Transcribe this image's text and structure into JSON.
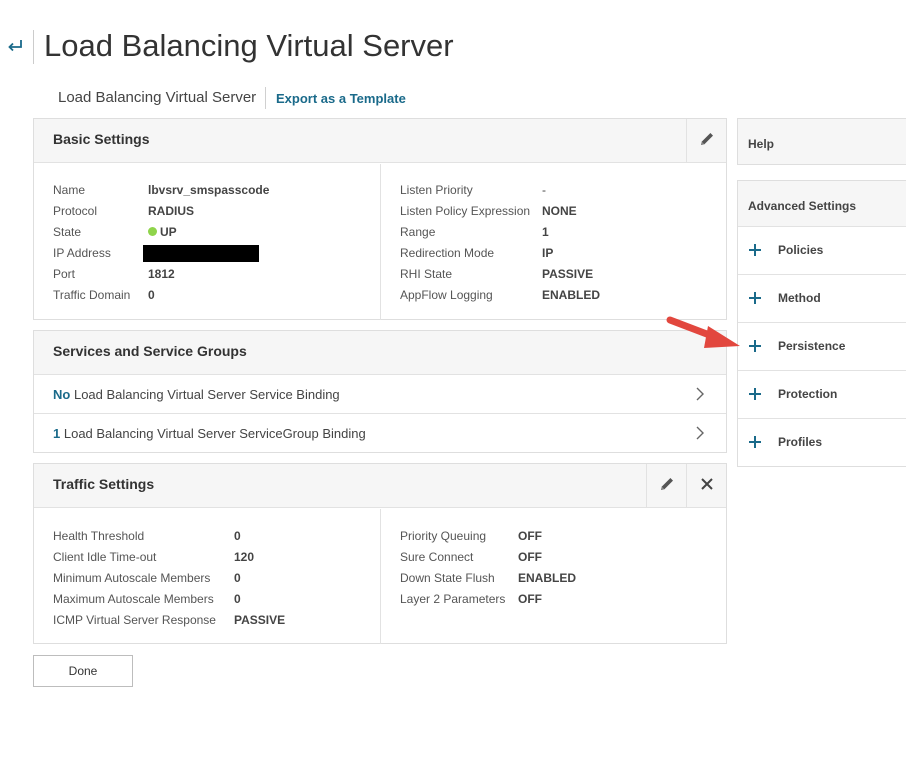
{
  "header": {
    "title": "Load Balancing Virtual Server",
    "breadcrumb": "Load Balancing Virtual Server",
    "export_link": "Export as a Template"
  },
  "basic_settings": {
    "title": "Basic Settings",
    "left": [
      {
        "label": "Name",
        "value": "lbvsrv_smspasscode"
      },
      {
        "label": "Protocol",
        "value": "RADIUS"
      },
      {
        "label": "State",
        "value": "UP"
      },
      {
        "label": "IP Address",
        "value": ""
      },
      {
        "label": "Port",
        "value": "1812"
      },
      {
        "label": "Traffic Domain",
        "value": "0"
      }
    ],
    "right": [
      {
        "label": "Listen Priority",
        "value": "-"
      },
      {
        "label": "Listen Policy Expression",
        "value": "NONE"
      },
      {
        "label": "Range",
        "value": "1"
      },
      {
        "label": "Redirection Mode",
        "value": "IP"
      },
      {
        "label": "RHI State",
        "value": "PASSIVE"
      },
      {
        "label": "AppFlow Logging",
        "value": "ENABLED"
      }
    ]
  },
  "services": {
    "title": "Services and Service Groups",
    "rows": [
      {
        "count": "No",
        "label": "Load Balancing Virtual Server Service Binding"
      },
      {
        "count": "1",
        "label": "Load Balancing Virtual Server ServiceGroup Binding"
      }
    ]
  },
  "traffic_settings": {
    "title": "Traffic Settings",
    "left": [
      {
        "label": "Health Threshold",
        "value": "0"
      },
      {
        "label": "Client Idle Time-out",
        "value": "120"
      },
      {
        "label": "Minimum Autoscale Members",
        "value": "0"
      },
      {
        "label": "Maximum Autoscale Members",
        "value": "0"
      },
      {
        "label": "ICMP Virtual Server Response",
        "value": "PASSIVE"
      }
    ],
    "right": [
      {
        "label": "Priority Queuing",
        "value": "OFF"
      },
      {
        "label": "Sure Connect",
        "value": "OFF"
      },
      {
        "label": "Down State Flush",
        "value": "ENABLED"
      },
      {
        "label": "Layer 2 Parameters",
        "value": "OFF"
      }
    ]
  },
  "done_label": "Done",
  "sidebar": {
    "help_label": "Help",
    "advanced_title": "Advanced Settings",
    "items": [
      {
        "label": "Policies"
      },
      {
        "label": "Method"
      },
      {
        "label": "Persistence"
      },
      {
        "label": "Protection"
      },
      {
        "label": "Profiles"
      }
    ]
  },
  "colors": {
    "accent": "#1a6a8a",
    "state_up": "#8fd44b",
    "arrow": "#e2473e"
  },
  "icons": [
    "back-arrow-icon",
    "pencil-icon",
    "close-icon",
    "chevron-right-icon",
    "plus-icon",
    "annotation-arrow-icon"
  ]
}
